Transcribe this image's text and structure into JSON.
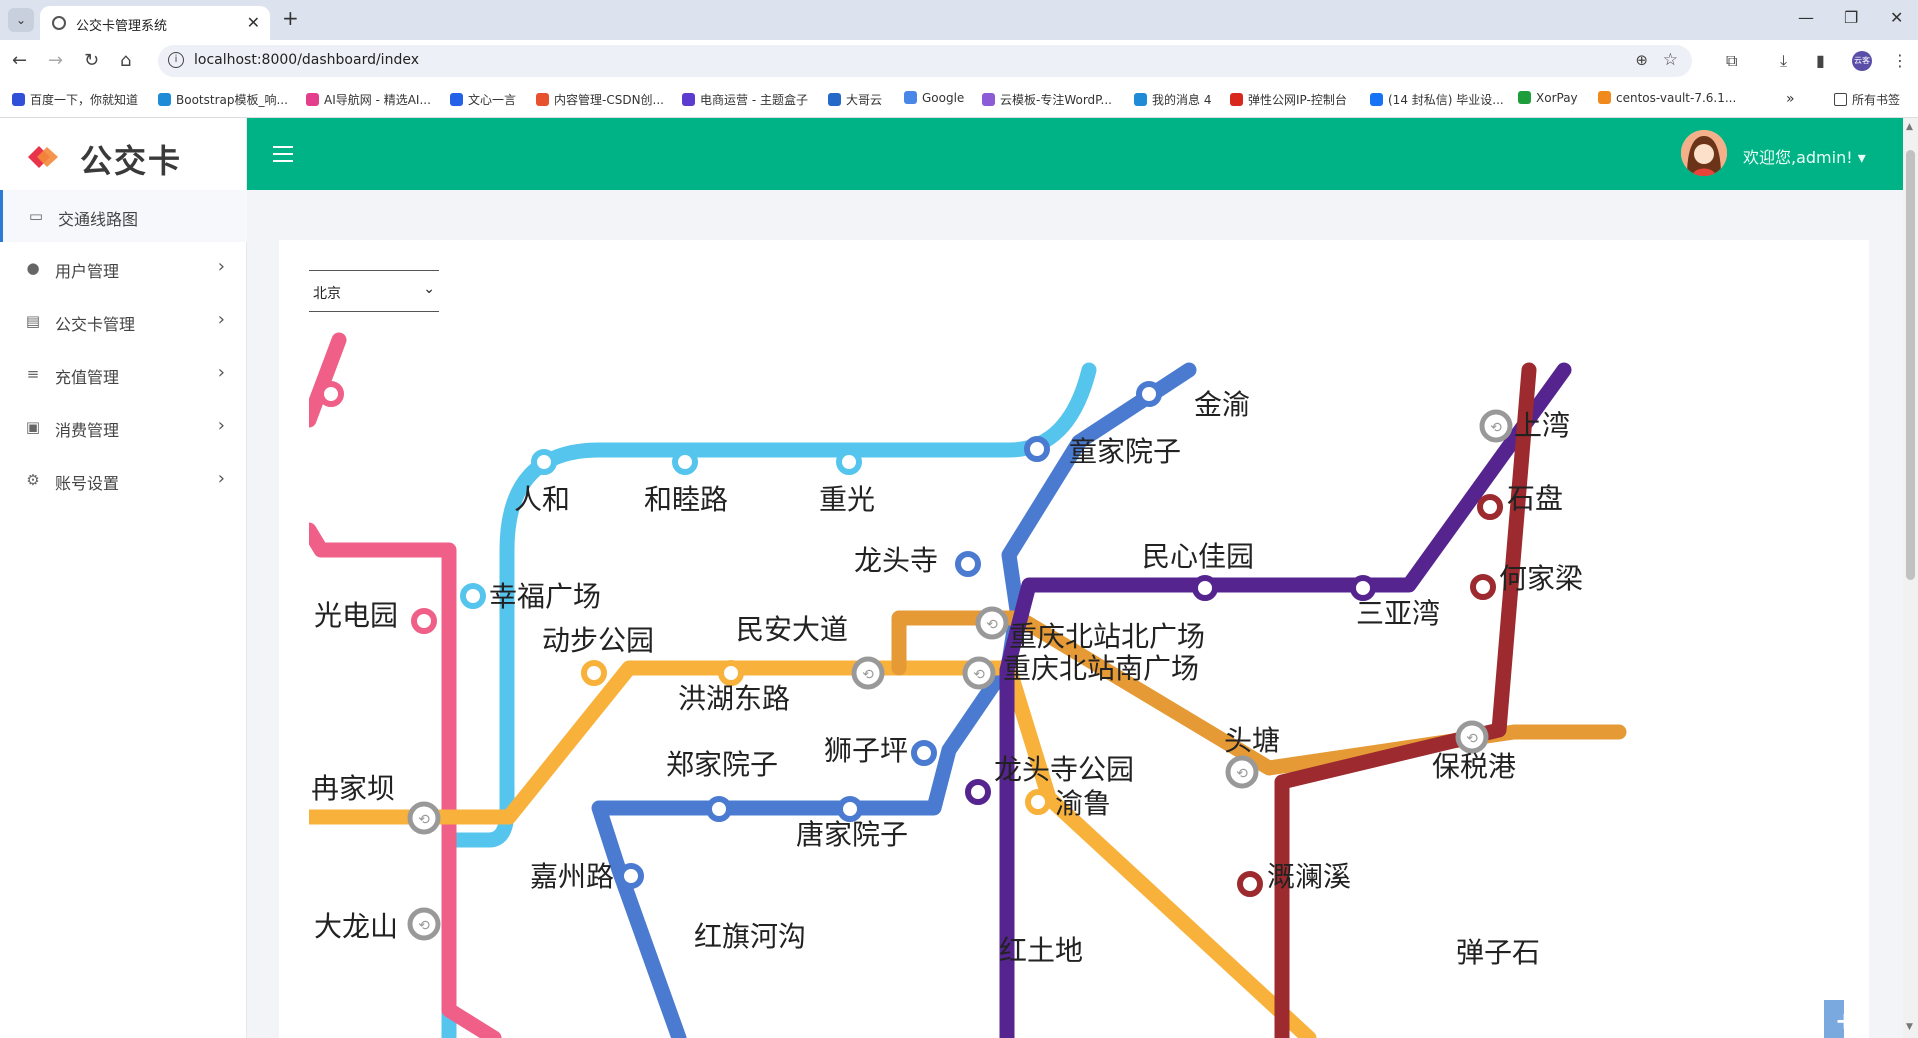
{
  "browser": {
    "tab_title": "公交卡管理系统",
    "url": "localhost:8000/dashboard/index",
    "bookmarks": [
      {
        "label": "百度一下，你就知道",
        "color": "#3050d8"
      },
      {
        "label": "Bootstrap模板_响...",
        "color": "#1f8bd6"
      },
      {
        "label": "AI导航网 - 精选AI...",
        "color": "#e43d8c"
      },
      {
        "label": "文心一言",
        "color": "#2460e8"
      },
      {
        "label": "内容管理-CSDN创...",
        "color": "#e8512e"
      },
      {
        "label": "电商运营 - 主题盒子",
        "color": "#5b3bd0"
      },
      {
        "label": "大哥云",
        "color": "#2468c8"
      },
      {
        "label": "Google",
        "color": "#4a86e8"
      },
      {
        "label": "云模板-专注WordP...",
        "color": "#8b5cd6"
      },
      {
        "label": "我的消息 4",
        "color": "#1f8bd6"
      },
      {
        "label": "弹性公网IP-控制台",
        "color": "#d8281e"
      },
      {
        "label": "(14 封私信) 毕业设...",
        "color": "#1772f5"
      },
      {
        "label": "XorPay",
        "color": "#1e9e3a"
      },
      {
        "label": "centos-vault-7.6.1...",
        "color": "#f08a1c"
      }
    ],
    "all_bookmarks": "所有书签",
    "profile_label": "云客"
  },
  "app": {
    "logo_text": "公交卡",
    "brand_color": "#00b386",
    "welcome": "欢迎您,admin!",
    "menu": [
      {
        "label": "交通线路图",
        "icon": "map-icon",
        "glyph": "▭",
        "active": true
      },
      {
        "label": "用户管理",
        "icon": "user-icon",
        "glyph": "●",
        "active": false
      },
      {
        "label": "公交卡管理",
        "icon": "calendar-icon",
        "glyph": "▤",
        "active": false
      },
      {
        "label": "充值管理",
        "icon": "list-icon",
        "glyph": "≡",
        "active": false
      },
      {
        "label": "消费管理",
        "icon": "card-icon",
        "glyph": "▣",
        "active": false
      },
      {
        "label": "账号设置",
        "icon": "gear-icon",
        "glyph": "⚙",
        "active": false
      }
    ],
    "city_select": {
      "value": "北京",
      "options": [
        "北京"
      ]
    },
    "zoom_in": "+",
    "zoom_out": "-"
  },
  "map": {
    "station_labels": [
      "金渝",
      "上湾",
      "童家院子",
      "人和",
      "和睦路",
      "重光",
      "石盘",
      "龙头寺",
      "民心佳园",
      "何家梁",
      "幸福广场",
      "光电园",
      "三亚湾",
      "民安大道",
      "重庆北站北广场",
      "动步公园",
      "重庆北站南广场",
      "洪湖东路",
      "头塘",
      "狮子坪",
      "保税港",
      "郑家院子",
      "龙头寺公园",
      "冉家坝",
      "渝鲁",
      "唐家院子",
      "嘉州路",
      "溉澜溪",
      "大龙山",
      "红旗河沟",
      "红土地",
      "弹子石"
    ],
    "line_colors": {
      "light_blue": "#55c5ee",
      "pink": "#ef5f87",
      "blue": "#4a7bd0",
      "purple": "#55248f",
      "orange": "#f8b23c",
      "dark_orange": "#e59a35",
      "dark_red": "#9c2a2e"
    }
  }
}
